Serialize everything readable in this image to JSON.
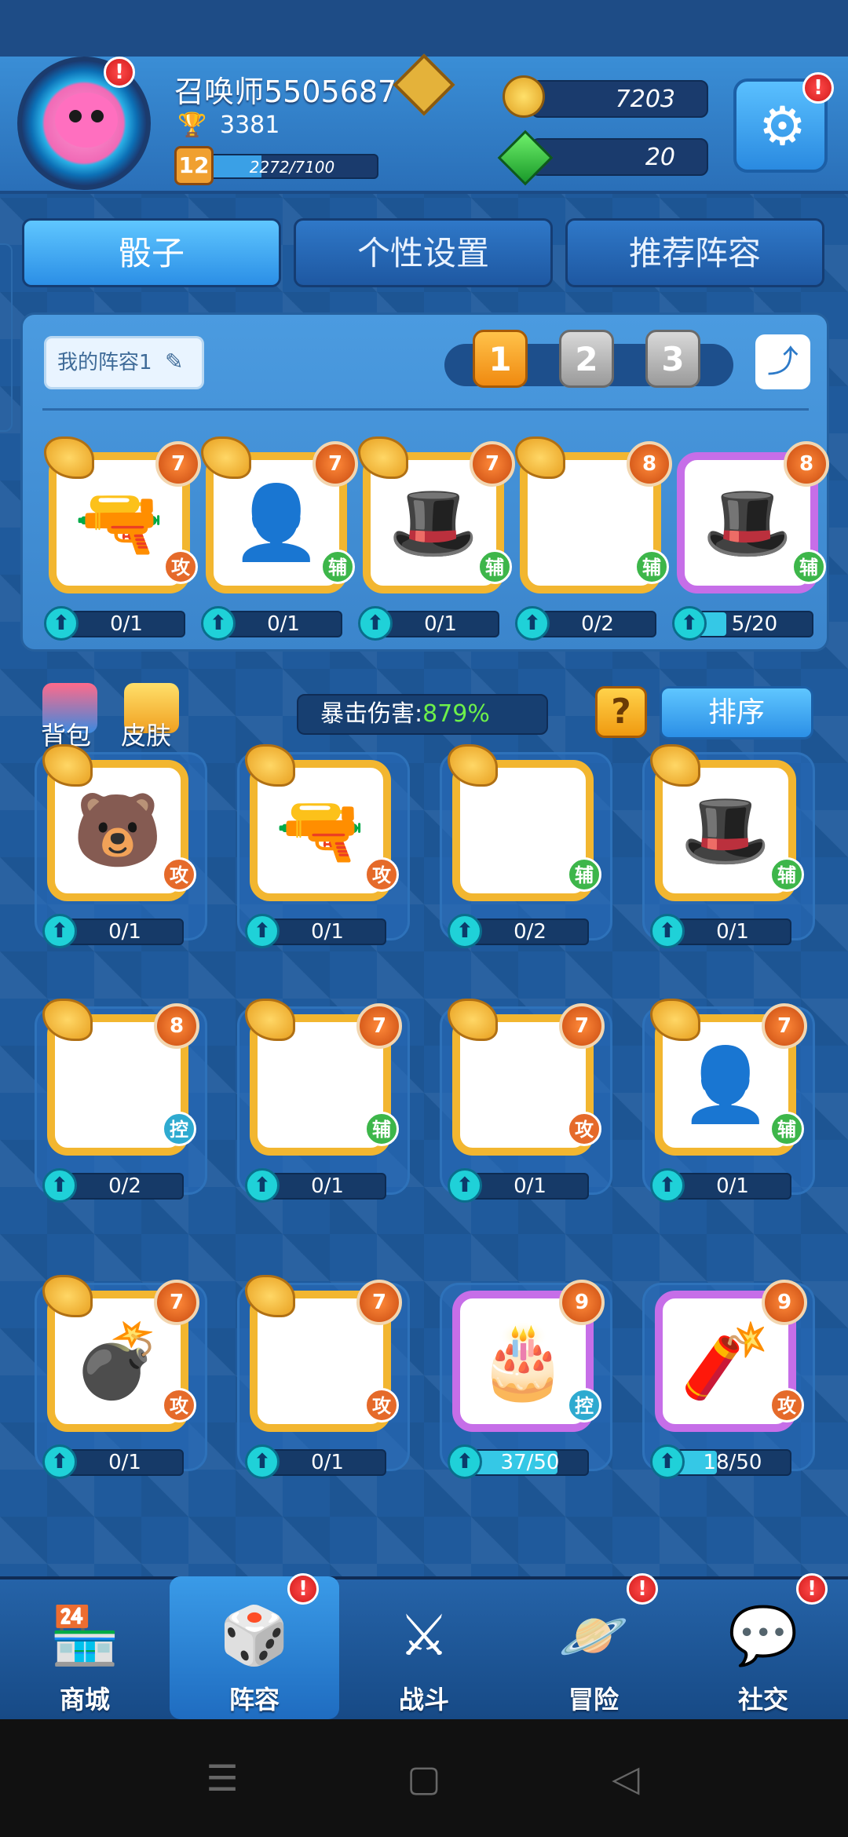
{
  "player": {
    "name": "召唤师5505687",
    "trophies": "3381",
    "level": "12",
    "exp_text": "2272/7100",
    "exp_progress": 0.32,
    "notification": "!"
  },
  "currency": {
    "coins": "7203",
    "gems": "20"
  },
  "settings": {
    "icon": "gear-icon",
    "notification": "!"
  },
  "tabs": [
    {
      "label": "骰子",
      "active": true
    },
    {
      "label": "个性设置",
      "active": false
    },
    {
      "label": "推荐阵容",
      "active": false
    }
  ],
  "lineup": {
    "name": "我的阵容1",
    "slots": [
      "1",
      "2",
      "3"
    ],
    "active_slot": "1",
    "dice": [
      {
        "icon": "revolver-icon",
        "level": "7",
        "type": "攻",
        "type_class": "atk",
        "progress": "0/1",
        "fill": 0
      },
      {
        "icon": "silhouette-icon",
        "level": "7",
        "type": "辅",
        "type_class": "sup",
        "progress": "0/1",
        "fill": 0
      },
      {
        "icon": "hat-icon",
        "level": "7",
        "type": "辅",
        "type_class": "sup",
        "progress": "0/1",
        "fill": 0
      },
      {
        "icon": "plus-icon",
        "level": "8",
        "type": "辅",
        "type_class": "sup",
        "progress": "0/2",
        "fill": 0
      },
      {
        "icon": "magic-hat-icon",
        "level": "8",
        "type": "辅",
        "type_class": "sup",
        "progress": "5/20",
        "fill": 0.25
      }
    ]
  },
  "middle": {
    "backpack_label": "背包",
    "skin_label": "皮肤",
    "crit_label": "暴击伤害:",
    "crit_value": "879%",
    "help": "?",
    "sort_label": "排序"
  },
  "collection": [
    {
      "icon": "beast-icon",
      "level": "",
      "type": "攻",
      "type_class": "atk",
      "progress": "0/1",
      "fill": 0
    },
    {
      "icon": "revolver-icon",
      "level": "",
      "type": "攻",
      "type_class": "atk",
      "progress": "0/1",
      "fill": 0
    },
    {
      "icon": "hexagram-icon",
      "level": "",
      "type": "辅",
      "type_class": "sup",
      "progress": "0/2",
      "fill": 0
    },
    {
      "icon": "hat-icon",
      "level": "",
      "type": "辅",
      "type_class": "sup",
      "progress": "0/1",
      "fill": 0
    },
    {
      "icon": "snowflake-icon",
      "level": "8",
      "type": "控",
      "type_class": "ctl",
      "progress": "0/2",
      "fill": 0
    },
    {
      "icon": "demon-icon",
      "level": "7",
      "type": "辅",
      "type_class": "sup",
      "progress": "0/1",
      "fill": 0
    },
    {
      "icon": "ice-spirit-icon",
      "level": "7",
      "type": "攻",
      "type_class": "atk",
      "progress": "0/1",
      "fill": 0
    },
    {
      "icon": "silhouette-icon",
      "level": "7",
      "type": "辅",
      "type_class": "sup",
      "progress": "0/1",
      "fill": 0
    },
    {
      "icon": "grenade-icon",
      "level": "7",
      "type": "攻",
      "type_class": "atk",
      "progress": "0/1",
      "fill": 0
    },
    {
      "icon": "bullet-icon",
      "level": "7",
      "type": "攻",
      "type_class": "atk",
      "progress": "0/1",
      "fill": 0
    },
    {
      "icon": "cake-icon",
      "level": "9",
      "type": "控",
      "type_class": "ctl",
      "progress": "37/50",
      "fill": 0.74
    },
    {
      "icon": "firecracker-icon",
      "level": "9",
      "type": "攻",
      "type_class": "atk",
      "progress": "18/50",
      "fill": 0.36
    }
  ],
  "nav": [
    {
      "label": "商城",
      "icon": "shop-icon",
      "active": false,
      "badge": ""
    },
    {
      "label": "阵容",
      "icon": "dice-icon",
      "active": true,
      "badge": "!"
    },
    {
      "label": "战斗",
      "icon": "swords-icon",
      "active": false,
      "badge": ""
    },
    {
      "label": "冒险",
      "icon": "planet-icon",
      "active": false,
      "badge": "!"
    },
    {
      "label": "社交",
      "icon": "chat-icon",
      "active": false,
      "badge": "!"
    }
  ],
  "colors": {
    "accent": "#2b8fe6",
    "gold": "#f2b630",
    "crit_green": "#6df04a"
  }
}
